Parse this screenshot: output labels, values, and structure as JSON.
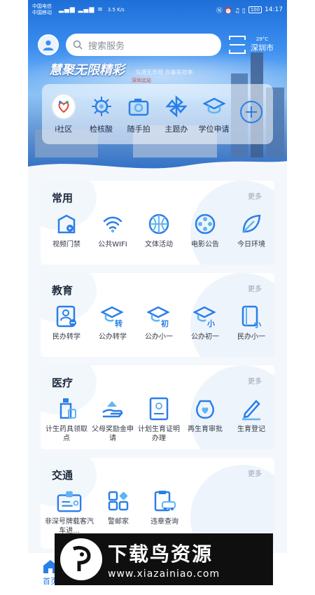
{
  "status_bar": {
    "carrier1": "中国电信",
    "carrier2": "中国移动",
    "network_speed": "3.5 K/s",
    "battery": "100",
    "time": "14:17"
  },
  "header": {
    "search_placeholder": "搜索服务",
    "temperature": "29°C",
    "city": "深圳市",
    "slogan": "慧聚无限精彩",
    "slogan_sub": "沟通无界限 办事有效率",
    "slogan_tag": "深圳北站"
  },
  "quick_actions": [
    {
      "label": "i社区",
      "icon": "community-icon"
    },
    {
      "label": "检核酸",
      "icon": "virus-icon"
    },
    {
      "label": "随手拍",
      "icon": "camera-icon"
    },
    {
      "label": "主题办",
      "icon": "pinwheel-icon"
    },
    {
      "label": "学位申请",
      "icon": "graduation-cap-icon"
    },
    {
      "label": "",
      "icon": "plus-circle-icon"
    }
  ],
  "sections": [
    {
      "title": "常用",
      "more": "更多",
      "items": [
        {
          "label": "视频门禁",
          "icon": "video-door-icon"
        },
        {
          "label": "公共WIFI",
          "icon": "wifi-icon"
        },
        {
          "label": "文体活动",
          "icon": "basketball-icon"
        },
        {
          "label": "电影公告",
          "icon": "film-reel-icon"
        },
        {
          "label": "今日环境",
          "icon": "leaf-icon"
        }
      ]
    },
    {
      "title": "教育",
      "more": "更多",
      "items": [
        {
          "label": "民办转学",
          "icon": "student-transfer-icon"
        },
        {
          "label": "公办转学",
          "icon": "cap-transfer-icon",
          "badge": "转"
        },
        {
          "label": "公办小一",
          "icon": "cap-primary-icon",
          "badge": "初"
        },
        {
          "label": "公办初一",
          "icon": "cap-junior-icon",
          "badge": "小"
        },
        {
          "label": "民办小一",
          "icon": "book-primary-icon",
          "badge": "小"
        }
      ]
    },
    {
      "title": "医疗",
      "more": "更多",
      "items": [
        {
          "label": "计生药具领取点",
          "icon": "medicine-bottle-icon"
        },
        {
          "label": "父母奖励金申请",
          "icon": "hand-reward-icon"
        },
        {
          "label": "计划生育证明办理",
          "icon": "certificate-icon"
        },
        {
          "label": "再生育审批",
          "icon": "heart-bag-icon"
        },
        {
          "label": "生育登记",
          "icon": "pen-register-icon"
        }
      ]
    },
    {
      "title": "交通",
      "more": "更多",
      "items": [
        {
          "label": "非深号牌载客汽车进...",
          "icon": "id-card-icon"
        },
        {
          "label": "警邮家",
          "icon": "blocks-icon"
        },
        {
          "label": "违章查询",
          "icon": "car-clipboard-icon"
        }
      ]
    }
  ],
  "tabbar": {
    "home_label": "首页"
  },
  "watermark": {
    "title": "下载鸟资源",
    "url": "www.xiazainiao.com"
  },
  "colors": {
    "primary": "#2a7fe8",
    "accent_light": "#5fb4f5",
    "banner": "#3b8ef0"
  }
}
